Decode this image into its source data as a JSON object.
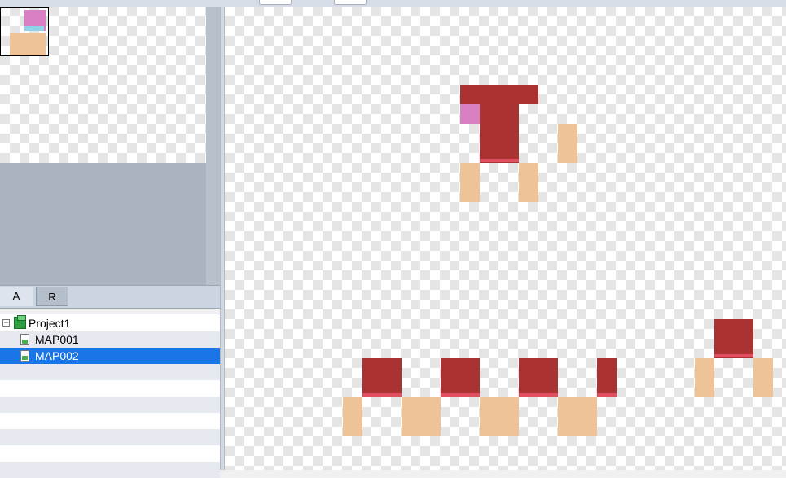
{
  "tabs": {
    "a": "A",
    "r": "R"
  },
  "tree": {
    "project": "Project1",
    "maps": [
      "MAP001",
      "MAP002"
    ]
  },
  "colors": {
    "selection": "#1a75e6",
    "red_tile": "#ab3232",
    "skin_tile": "#eec398",
    "pink_tile": "#d97fc4"
  }
}
